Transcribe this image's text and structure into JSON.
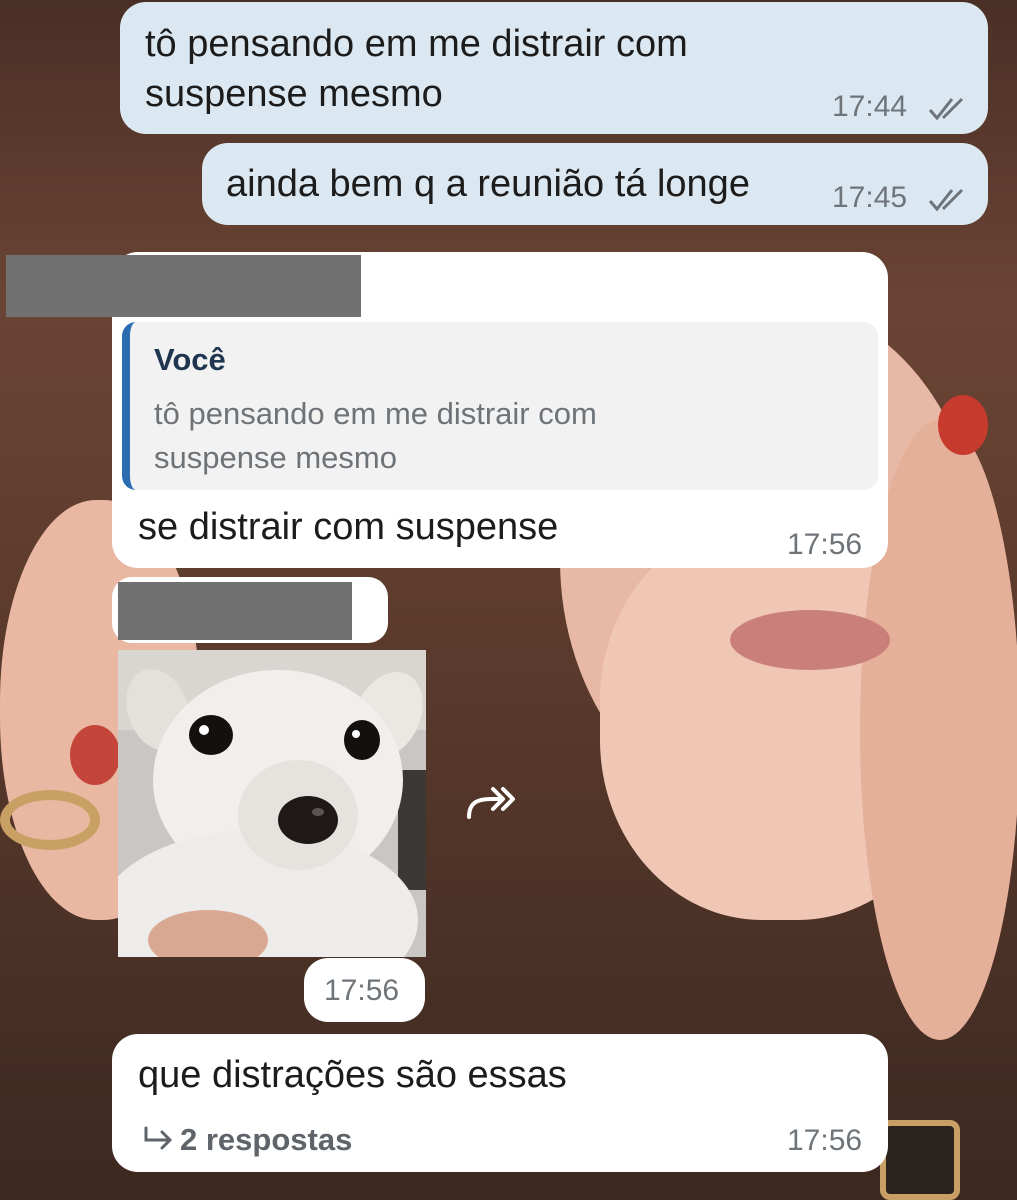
{
  "messages": [
    {
      "sender": "self",
      "text": "tô pensando em me distrair com suspense mesmo",
      "time": "17:44",
      "status": "read"
    },
    {
      "sender": "self",
      "text": "ainda bem q a reunião tá longe",
      "time": "17:45",
      "status": "read"
    },
    {
      "sender": "other",
      "reply_to": {
        "author": "Você",
        "text": "tô pensando em me distrair com suspense mesmo"
      },
      "text": "se distrair com suspense",
      "time": "17:56"
    },
    {
      "sender": "other",
      "type": "sticker",
      "sticker_icon": "puppy-sticker",
      "time": "17:56"
    },
    {
      "sender": "other",
      "text": "que distrações são essas",
      "time": "17:56",
      "replies_label": "2 respostas"
    }
  ],
  "icons": {
    "read_ticks": "double-check-icon",
    "forward": "forward-icon",
    "reply_arrow": "reply-arrow-icon"
  },
  "colors": {
    "outgoing_bubble": "#dce8f1",
    "incoming_bubble": "#ffffff",
    "quote_bar": "#2a6db0",
    "quote_author": "#1f3550"
  }
}
